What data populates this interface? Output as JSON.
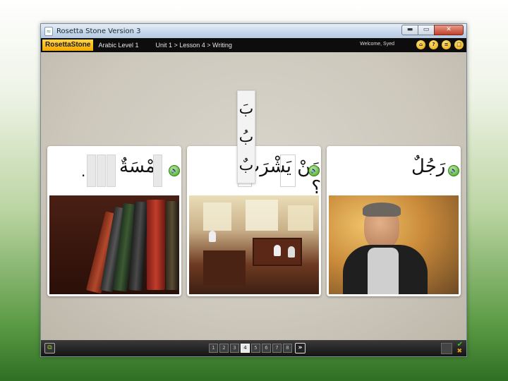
{
  "window": {
    "title": "Rosetta Stone Version 3",
    "buttons": {
      "minimize": "▬",
      "maximize": "▭",
      "close": "✕"
    }
  },
  "nav": {
    "logo": "RosettaStone",
    "level": "Arabic Level 1",
    "breadcrumb": "Unit 1 > Lesson 4 > Writing",
    "welcome": "Welcome, Syed",
    "icons": [
      "home-icon",
      "help-icon",
      "menu-icon",
      "window-icon"
    ],
    "icon_glyphs": [
      "⌂",
      "?",
      "≡",
      "□"
    ]
  },
  "cards": [
    {
      "arabic": "ـمْسَةٌ",
      "period": ".",
      "speaker": "🔊"
    },
    {
      "arabic": "مَنْ يَشْرَبُ ؟",
      "speaker": "🔊"
    },
    {
      "arabic": "رَجُلٌ",
      "speaker": "🔊"
    }
  ],
  "tiles": [
    "بَ",
    "بُ",
    "بٌ"
  ],
  "bottom": {
    "left_icon_glyph": "⧉",
    "pages": [
      "1",
      "2",
      "3",
      "4",
      "5",
      "6",
      "7",
      "8"
    ],
    "current_page": 4,
    "next_glyph": "»",
    "check_glyph": "✔",
    "x_glyph": "✖"
  },
  "colors": {
    "accent": "#f4a900",
    "speaker_green": "#3ea21a"
  }
}
